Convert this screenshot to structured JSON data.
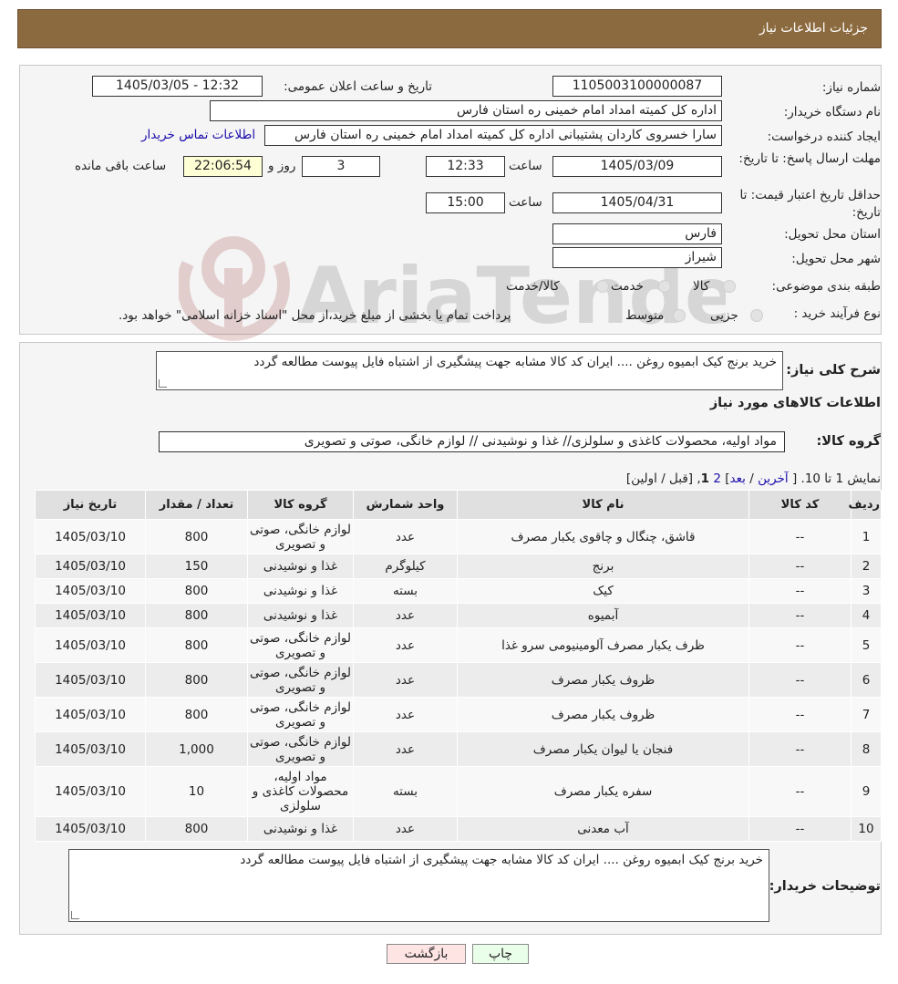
{
  "header": {
    "title": "جزئیات اطلاعات نیاز"
  },
  "watermark": {
    "text": "AriaTender.neT"
  },
  "form": {
    "need_number_label": "شماره نیاز:",
    "need_number": "1105003100000087",
    "announce_label": "تاریخ و ساعت اعلان عمومی:",
    "announce_value": "1405/03/05 - 12:32",
    "buyer_org_label": "نام دستگاه خریدار:",
    "buyer_org": "اداره کل کمیته امداد امام خمینی  ره  استان فارس",
    "creator_label": "ایجاد کننده درخواست:",
    "creator": "سارا خسروی کاردان پشتیبانی  اداره کل کمیته امداد امام خمینی  ره  استان فارس",
    "contact_link": "اطلاعات تماس خریدار",
    "deadline_label": "مهلت ارسال پاسخ: تا تاریخ:",
    "deadline_date": "1405/03/09",
    "time_label": "ساعت",
    "deadline_time": "12:33",
    "days_value": "3",
    "days_label": "روز و",
    "remaining_time": "22:06:54",
    "remaining_label": "ساعت باقی مانده",
    "validity_label": "حداقل تاریخ اعتبار قیمت: تا تاریخ:",
    "validity_date": "1405/04/31",
    "validity_time": "15:00",
    "province_label": "استان محل تحویل:",
    "province": "فارس",
    "city_label": "شهر محل تحویل:",
    "city": "شیراز",
    "category_label": "طبقه بندی موضوعی:",
    "category_options": [
      "کالا",
      "خدمت",
      "کالا/خدمت"
    ],
    "process_label": "نوع فرآیند خرید :",
    "process_options": [
      "جزیی",
      "متوسط"
    ],
    "process_note": "پرداخت تمام یا بخشی از مبلغ خرید،از محل \"اسناد خزانه اسلامی\" خواهد بود."
  },
  "summary": {
    "description_label": "شرح کلی نیاز:",
    "description": "خرید برنج کیک ابمیوه روغن .... ایران کد کالا مشابه جهت پیشگیری از اشتباه فایل پیوست مطالعه گردد",
    "goods_info_title": "اطلاعات کالاهای مورد نیاز",
    "goods_group_label": "گروه کالا:",
    "goods_group": "مواد اولیه، محصولات کاغذی و سلولزی// غذا و نوشیدنی // لوازم خانگی، صوتی و تصویری",
    "pagination": {
      "showing": "نمایش 1 تا 10.",
      "open": "[",
      "last": "آخرین",
      "sep1": "/",
      "next": "بعد",
      "close1": "]",
      "page2": "2",
      "page1": "1",
      "comma": ",",
      "prev_first": "[قبل / اولین]"
    },
    "columns": [
      "ردیف",
      "کد کالا",
      "نام کالا",
      "واحد شمارش",
      "گروه کالا",
      "تعداد / مقدار",
      "تاریخ نیاز"
    ],
    "rows": [
      {
        "idx": "1",
        "code": "--",
        "name": "قاشق، چنگال و چاقوی یکبار مصرف",
        "unit": "عدد",
        "group": "لوازم خانگی، صوتی و تصویری",
        "qty": "800",
        "date": "1405/03/10"
      },
      {
        "idx": "2",
        "code": "--",
        "name": "برنج",
        "unit": "کیلوگرم",
        "group": "غذا و نوشیدنی",
        "qty": "150",
        "date": "1405/03/10"
      },
      {
        "idx": "3",
        "code": "--",
        "name": "کیک",
        "unit": "بسته",
        "group": "غذا و نوشیدنی",
        "qty": "800",
        "date": "1405/03/10"
      },
      {
        "idx": "4",
        "code": "--",
        "name": "آبمیوه",
        "unit": "عدد",
        "group": "غذا و نوشیدنی",
        "qty": "800",
        "date": "1405/03/10"
      },
      {
        "idx": "5",
        "code": "--",
        "name": "ظرف یکبار مصرف آلومینیومی سرو غذا",
        "unit": "عدد",
        "group": "لوازم خانگی، صوتی و تصویری",
        "qty": "800",
        "date": "1405/03/10"
      },
      {
        "idx": "6",
        "code": "--",
        "name": "ظروف یکبار مصرف",
        "unit": "عدد",
        "group": "لوازم خانگی، صوتی و تصویری",
        "qty": "800",
        "date": "1405/03/10"
      },
      {
        "idx": "7",
        "code": "--",
        "name": "ظروف یکبار مصرف",
        "unit": "عدد",
        "group": "لوازم خانگی، صوتی و تصویری",
        "qty": "800",
        "date": "1405/03/10"
      },
      {
        "idx": "8",
        "code": "--",
        "name": "فنجان یا لیوان یکبار مصرف",
        "unit": "عدد",
        "group": "لوازم خانگی، صوتی و تصویری",
        "qty": "1,000",
        "date": "1405/03/10"
      },
      {
        "idx": "9",
        "code": "--",
        "name": "سفره یکبار مصرف",
        "unit": "بسته",
        "group": "مواد اولیه، محصولات کاغذی و سلولزی",
        "qty": "10",
        "date": "1405/03/10"
      },
      {
        "idx": "10",
        "code": "--",
        "name": "آب معدنی",
        "unit": "عدد",
        "group": "غذا و نوشیدنی",
        "qty": "800",
        "date": "1405/03/10"
      }
    ],
    "buyer_notes_label": "توضیحات خریدار:",
    "buyer_notes": "خرید برنج کیک ابمیوه روغن .... ایران کد کالا مشابه جهت پیشگیری از اشتباه فایل پیوست مطالعه گردد"
  },
  "buttons": {
    "print": "چاپ",
    "back": "بازگشت"
  },
  "colors": {
    "header": "#8c6a3f",
    "link": "#1a0dab",
    "remaining_bg": "#ffffd6",
    "print_bg": "#eaffea",
    "back_bg": "#ffe4e4"
  }
}
